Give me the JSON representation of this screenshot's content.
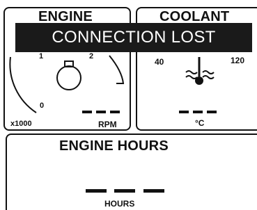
{
  "banner": {
    "text": "CONNECTION LOST"
  },
  "engine": {
    "title": "ENGINE",
    "scale": {
      "min_label": "0",
      "one_label": "1",
      "two_label": "2",
      "multiplier": "x1000"
    },
    "reading": "– – –",
    "unit": "RPM",
    "icon": "engine-icon"
  },
  "coolant": {
    "title": "COOLANT",
    "scale": {
      "low_label": "40",
      "high_label": "120"
    },
    "reading": "– – –",
    "unit": "°C",
    "icon": "coolant-temperature-icon"
  },
  "hours": {
    "title": "ENGINE HOURS",
    "reading": "— — —",
    "unit": "HOURS"
  },
  "colors": {
    "foreground": "#111111",
    "banner_bg": "#1a1a1a",
    "banner_text": "#ffffff",
    "background": "#ffffff"
  }
}
